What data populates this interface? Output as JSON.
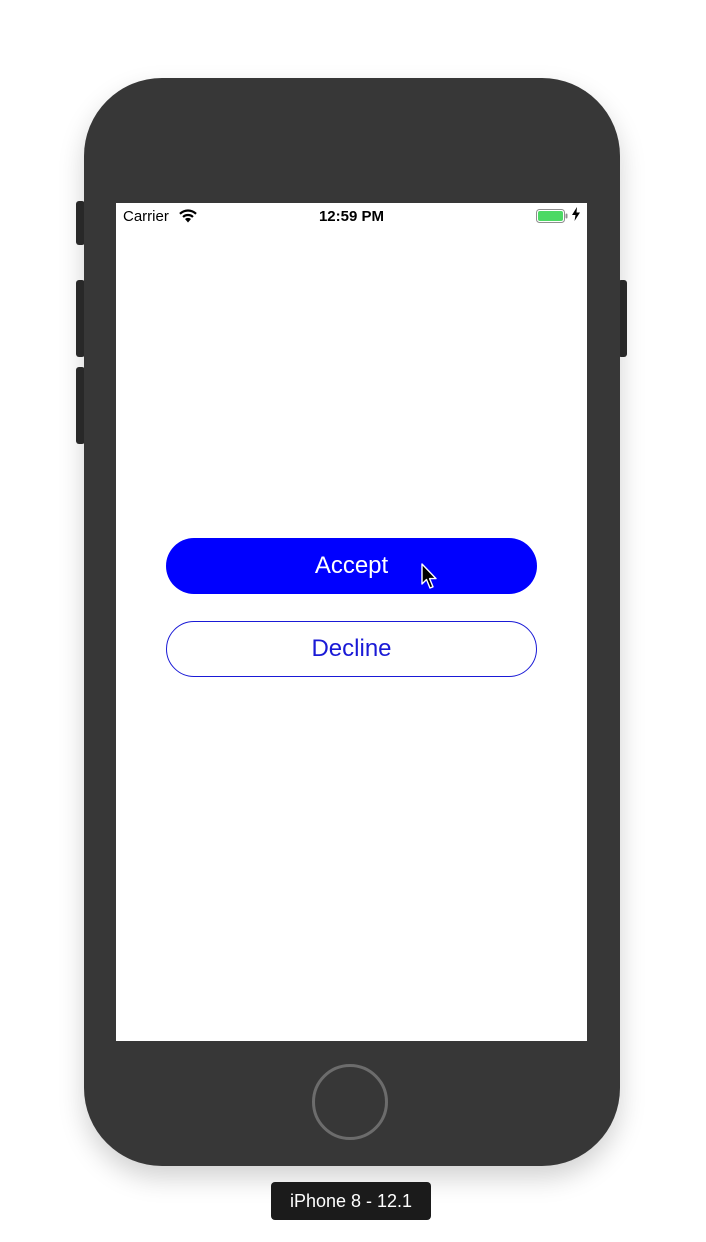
{
  "status_bar": {
    "carrier": "Carrier",
    "time": "12:59 PM",
    "wifi_icon": "wifi-icon",
    "battery_icon": "battery-icon",
    "charging_icon": "charging-bolt-icon",
    "battery_color": "#4cd964"
  },
  "buttons": {
    "accept_label": "Accept",
    "decline_label": "Decline",
    "accept_color": "#0000ff",
    "decline_color": "#1a1ad6"
  },
  "device": {
    "label": "iPhone 8 - 12.1"
  }
}
